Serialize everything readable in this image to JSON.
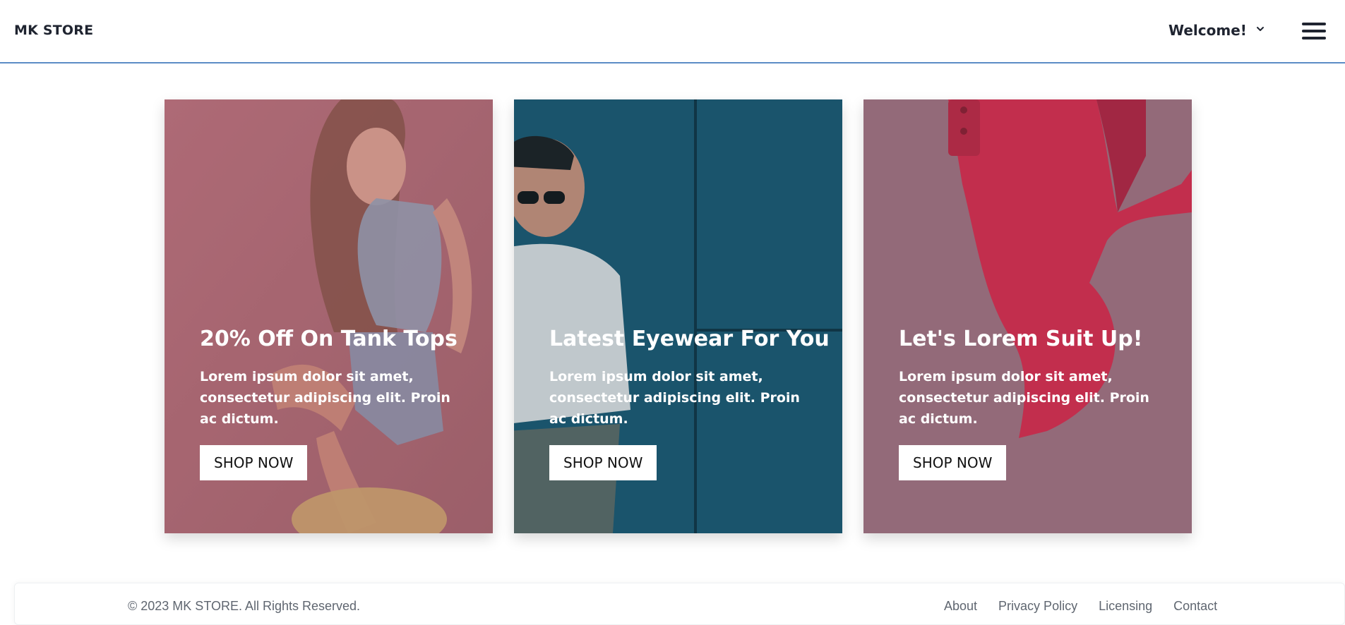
{
  "header": {
    "brand": "MK STORE",
    "welcome_label": "Welcome!",
    "welcome_icon": "chevron-down-icon",
    "menu_icon": "hamburger-menu-icon"
  },
  "cards": [
    {
      "title": "20% Off On Tank Tops",
      "text": "Lorem ipsum dolor sit amet, consectetur adipiscing elit. Proin ac dictum.",
      "button": "SHOP NOW",
      "overlay_color": "#a06670"
    },
    {
      "title": "Latest Eyewear For You",
      "text": "Lorem ipsum dolor sit amet, consectetur adipiscing elit. Proin ac dictum.",
      "button": "SHOP NOW",
      "overlay_color": "#1f5a72"
    },
    {
      "title": "Let's Lorem Suit Up!",
      "text": "Lorem ipsum dolor sit amet, consectetur adipiscing elit. Proin ac dictum.",
      "button": "SHOP NOW",
      "overlay_color": "#8e6b79"
    }
  ],
  "footer": {
    "copyright": "© 2023 MK STORE. All Rights Reserved.",
    "links": [
      "About",
      "Privacy Policy",
      "Licensing",
      "Contact"
    ]
  }
}
